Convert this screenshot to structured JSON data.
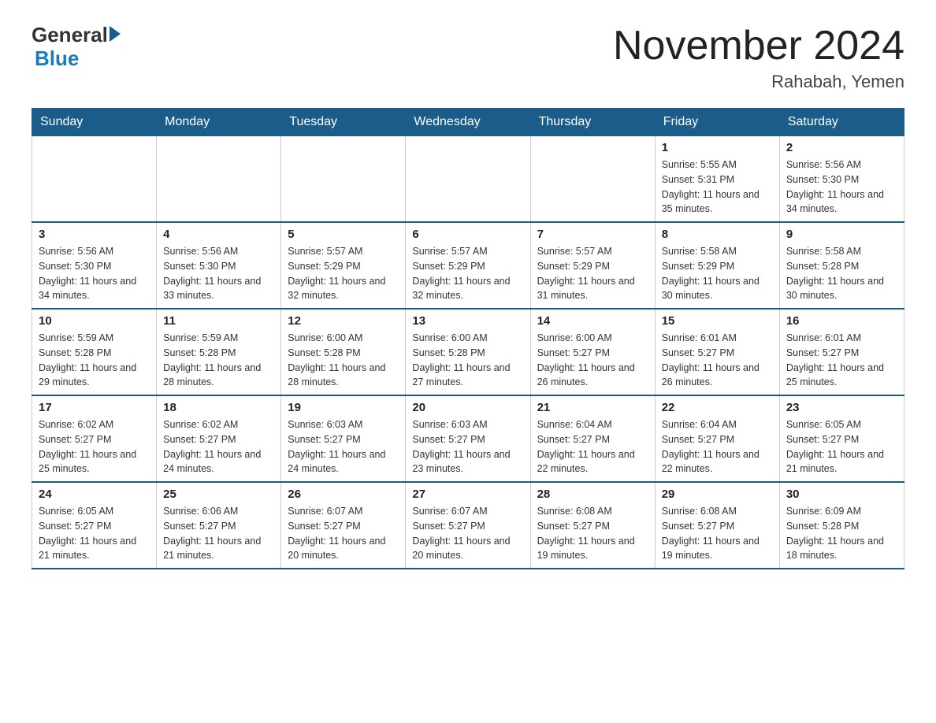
{
  "logo": {
    "general": "General",
    "blue": "Blue"
  },
  "title": "November 2024",
  "subtitle": "Rahabah, Yemen",
  "days_of_week": [
    "Sunday",
    "Monday",
    "Tuesday",
    "Wednesday",
    "Thursday",
    "Friday",
    "Saturday"
  ],
  "weeks": [
    [
      {
        "day": "",
        "info": ""
      },
      {
        "day": "",
        "info": ""
      },
      {
        "day": "",
        "info": ""
      },
      {
        "day": "",
        "info": ""
      },
      {
        "day": "",
        "info": ""
      },
      {
        "day": "1",
        "info": "Sunrise: 5:55 AM\nSunset: 5:31 PM\nDaylight: 11 hours and 35 minutes."
      },
      {
        "day": "2",
        "info": "Sunrise: 5:56 AM\nSunset: 5:30 PM\nDaylight: 11 hours and 34 minutes."
      }
    ],
    [
      {
        "day": "3",
        "info": "Sunrise: 5:56 AM\nSunset: 5:30 PM\nDaylight: 11 hours and 34 minutes."
      },
      {
        "day": "4",
        "info": "Sunrise: 5:56 AM\nSunset: 5:30 PM\nDaylight: 11 hours and 33 minutes."
      },
      {
        "day": "5",
        "info": "Sunrise: 5:57 AM\nSunset: 5:29 PM\nDaylight: 11 hours and 32 minutes."
      },
      {
        "day": "6",
        "info": "Sunrise: 5:57 AM\nSunset: 5:29 PM\nDaylight: 11 hours and 32 minutes."
      },
      {
        "day": "7",
        "info": "Sunrise: 5:57 AM\nSunset: 5:29 PM\nDaylight: 11 hours and 31 minutes."
      },
      {
        "day": "8",
        "info": "Sunrise: 5:58 AM\nSunset: 5:29 PM\nDaylight: 11 hours and 30 minutes."
      },
      {
        "day": "9",
        "info": "Sunrise: 5:58 AM\nSunset: 5:28 PM\nDaylight: 11 hours and 30 minutes."
      }
    ],
    [
      {
        "day": "10",
        "info": "Sunrise: 5:59 AM\nSunset: 5:28 PM\nDaylight: 11 hours and 29 minutes."
      },
      {
        "day": "11",
        "info": "Sunrise: 5:59 AM\nSunset: 5:28 PM\nDaylight: 11 hours and 28 minutes."
      },
      {
        "day": "12",
        "info": "Sunrise: 6:00 AM\nSunset: 5:28 PM\nDaylight: 11 hours and 28 minutes."
      },
      {
        "day": "13",
        "info": "Sunrise: 6:00 AM\nSunset: 5:28 PM\nDaylight: 11 hours and 27 minutes."
      },
      {
        "day": "14",
        "info": "Sunrise: 6:00 AM\nSunset: 5:27 PM\nDaylight: 11 hours and 26 minutes."
      },
      {
        "day": "15",
        "info": "Sunrise: 6:01 AM\nSunset: 5:27 PM\nDaylight: 11 hours and 26 minutes."
      },
      {
        "day": "16",
        "info": "Sunrise: 6:01 AM\nSunset: 5:27 PM\nDaylight: 11 hours and 25 minutes."
      }
    ],
    [
      {
        "day": "17",
        "info": "Sunrise: 6:02 AM\nSunset: 5:27 PM\nDaylight: 11 hours and 25 minutes."
      },
      {
        "day": "18",
        "info": "Sunrise: 6:02 AM\nSunset: 5:27 PM\nDaylight: 11 hours and 24 minutes."
      },
      {
        "day": "19",
        "info": "Sunrise: 6:03 AM\nSunset: 5:27 PM\nDaylight: 11 hours and 24 minutes."
      },
      {
        "day": "20",
        "info": "Sunrise: 6:03 AM\nSunset: 5:27 PM\nDaylight: 11 hours and 23 minutes."
      },
      {
        "day": "21",
        "info": "Sunrise: 6:04 AM\nSunset: 5:27 PM\nDaylight: 11 hours and 22 minutes."
      },
      {
        "day": "22",
        "info": "Sunrise: 6:04 AM\nSunset: 5:27 PM\nDaylight: 11 hours and 22 minutes."
      },
      {
        "day": "23",
        "info": "Sunrise: 6:05 AM\nSunset: 5:27 PM\nDaylight: 11 hours and 21 minutes."
      }
    ],
    [
      {
        "day": "24",
        "info": "Sunrise: 6:05 AM\nSunset: 5:27 PM\nDaylight: 11 hours and 21 minutes."
      },
      {
        "day": "25",
        "info": "Sunrise: 6:06 AM\nSunset: 5:27 PM\nDaylight: 11 hours and 21 minutes."
      },
      {
        "day": "26",
        "info": "Sunrise: 6:07 AM\nSunset: 5:27 PM\nDaylight: 11 hours and 20 minutes."
      },
      {
        "day": "27",
        "info": "Sunrise: 6:07 AM\nSunset: 5:27 PM\nDaylight: 11 hours and 20 minutes."
      },
      {
        "day": "28",
        "info": "Sunrise: 6:08 AM\nSunset: 5:27 PM\nDaylight: 11 hours and 19 minutes."
      },
      {
        "day": "29",
        "info": "Sunrise: 6:08 AM\nSunset: 5:27 PM\nDaylight: 11 hours and 19 minutes."
      },
      {
        "day": "30",
        "info": "Sunrise: 6:09 AM\nSunset: 5:28 PM\nDaylight: 11 hours and 18 minutes."
      }
    ]
  ]
}
